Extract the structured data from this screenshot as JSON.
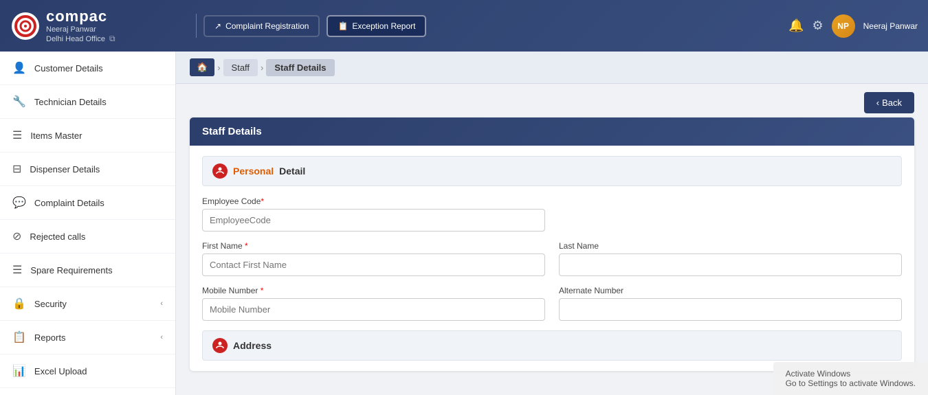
{
  "header": {
    "brand": "compac",
    "user_name": "Neeraj Panwar",
    "office": "Delhi Head Office",
    "initials": "NP",
    "complaint_btn": "Complaint Registration",
    "exception_btn": "Exception Report"
  },
  "breadcrumb": {
    "home_icon": "🏠",
    "items": [
      "Staff",
      "Staff Details"
    ]
  },
  "back_button": "‹ Back",
  "sidebar": {
    "items": [
      {
        "icon": "👤",
        "label": "Customer Details",
        "arrow": false
      },
      {
        "icon": "🔧",
        "label": "Technician Details",
        "arrow": false
      },
      {
        "icon": "☰",
        "label": "Items Master",
        "arrow": false
      },
      {
        "icon": "⊟",
        "label": "Dispenser Details",
        "arrow": false
      },
      {
        "icon": "💬",
        "label": "Complaint Details",
        "arrow": false
      },
      {
        "icon": "⊘",
        "label": "Rejected calls",
        "arrow": false
      },
      {
        "icon": "☰",
        "label": "Spare Requirements",
        "arrow": false
      },
      {
        "icon": "🔒",
        "label": "Security",
        "arrow": true
      },
      {
        "icon": "📋",
        "label": "Reports",
        "arrow": true
      },
      {
        "icon": "📊",
        "label": "Excel Upload",
        "arrow": false
      }
    ]
  },
  "card": {
    "title": "Staff Details",
    "personal_section": "Personal",
    "personal_detail": "Detail",
    "fields": {
      "employee_code_label": "Employee Code",
      "employee_code_placeholder": "EmployeeCode",
      "first_name_label": "First Name",
      "first_name_placeholder": "Contact First Name",
      "last_name_label": "Last Name",
      "last_name_placeholder": "",
      "mobile_number_label": "Mobile Number",
      "mobile_number_placeholder": "Mobile Number",
      "alternate_number_label": "Alternate Number",
      "alternate_number_placeholder": ""
    },
    "address_section": "Address"
  },
  "windows_activate": {
    "line1": "Activate Windows",
    "line2": "Go to Settings to activate Windows."
  }
}
